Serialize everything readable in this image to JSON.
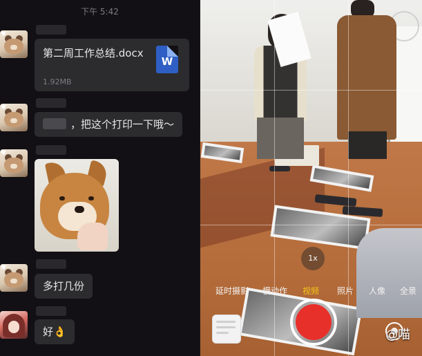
{
  "status_bar": {
    "time": "下午 5:42"
  },
  "chat": {
    "file_message": {
      "file_name": "第二周工作总结.docx",
      "file_size": "1.92MB",
      "file_icon_letter": "W",
      "icon": "word-file-icon"
    },
    "text_message_1": {
      "text": "，把这个打印一下哦～"
    },
    "sticker": {
      "icon": "shiba-dog-sticker"
    },
    "text_message_2": {
      "text": "多打几份"
    },
    "reply_message": {
      "text": "好👌"
    }
  },
  "camera": {
    "zoom_level": "1x",
    "modes": [
      "延时摄影",
      "慢动作",
      "视频",
      "照片",
      "人像",
      "全景"
    ],
    "active_mode": "视频",
    "shutter_color": "#e8302a",
    "watermark": "@喵"
  }
}
